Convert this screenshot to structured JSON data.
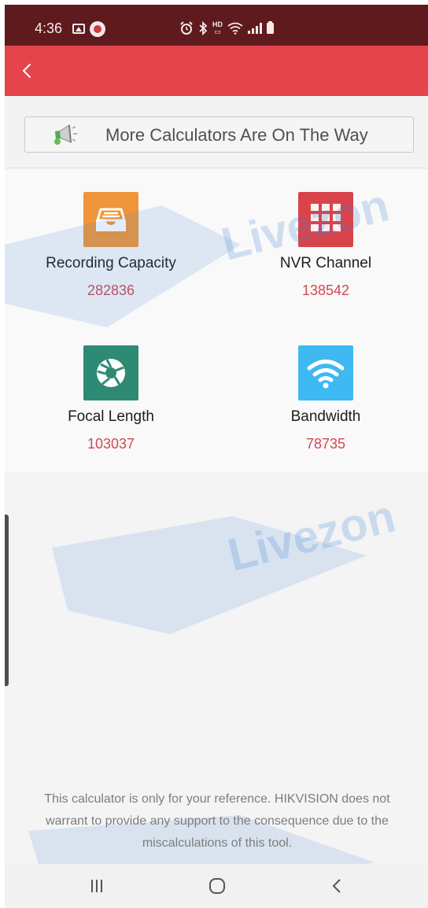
{
  "status_bar": {
    "time": "4:36",
    "hd_label": "HD",
    "icons": [
      "gallery-icon",
      "app-notification-icon",
      "alarm-icon",
      "bluetooth-icon",
      "wifi-icon",
      "signal-icon",
      "battery-icon"
    ]
  },
  "header": {
    "back_icon": "chevron-left-icon",
    "color": "#e5444d"
  },
  "banner": {
    "label": "More Calculators Are On The Way",
    "icon": "megaphone-icon"
  },
  "calculators": [
    {
      "label": "Recording Capacity",
      "count": "282836",
      "icon": "inbox-tray-icon",
      "color": "#f0953a"
    },
    {
      "label": "NVR Channel",
      "count": "138542",
      "icon": "grid-icon",
      "color": "#d9444b"
    },
    {
      "label": "Focal Length",
      "count": "103037",
      "icon": "aperture-icon",
      "color": "#2f8a73"
    },
    {
      "label": "Bandwidth",
      "count": "78735",
      "icon": "wifi-icon",
      "color": "#3eb9f2"
    }
  ],
  "disclaimer": {
    "text": "This calculator is only for your reference. HIKVISION does not warrant to provide any support to the consequence due to the miscalculations of this tool."
  },
  "watermark": {
    "text": "Livezon",
    "color": "#3a7fd1"
  },
  "nav_bar": {
    "icons": [
      "recents-icon",
      "home-icon",
      "back-icon"
    ]
  },
  "colors": {
    "status_bar": "#5f1a1e",
    "count_text": "#cf4a52"
  }
}
